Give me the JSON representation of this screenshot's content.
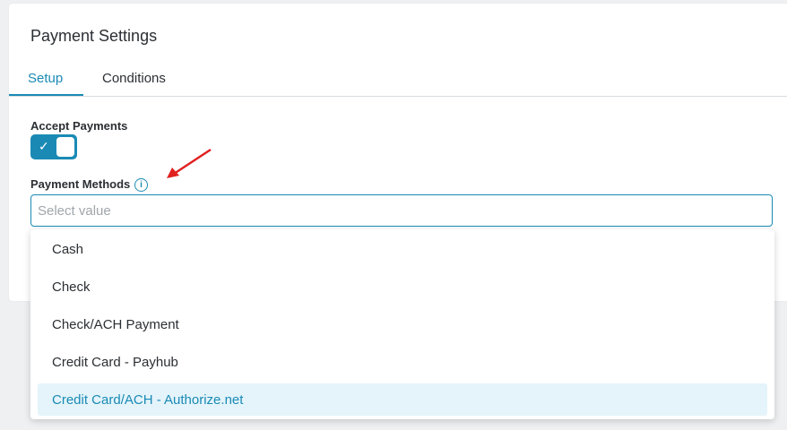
{
  "header": {
    "title": "Payment Settings"
  },
  "tabs": [
    {
      "label": "Setup",
      "active": true
    },
    {
      "label": "Conditions",
      "active": false
    }
  ],
  "accept_payments": {
    "label": "Accept Payments",
    "enabled": true
  },
  "payment_methods": {
    "label": "Payment Methods",
    "info_icon": "info-icon",
    "placeholder": "Select value",
    "value": "",
    "options": [
      "Cash",
      "Check",
      "Check/ACH Payment",
      "Credit Card - Payhub",
      "Credit Card/ACH  - Authorize.net"
    ],
    "highlighted_index": 4
  },
  "colors": {
    "accent": "#1a8ab5",
    "highlight": "#e4f4fa",
    "annotation_arrow": "#e02020"
  }
}
